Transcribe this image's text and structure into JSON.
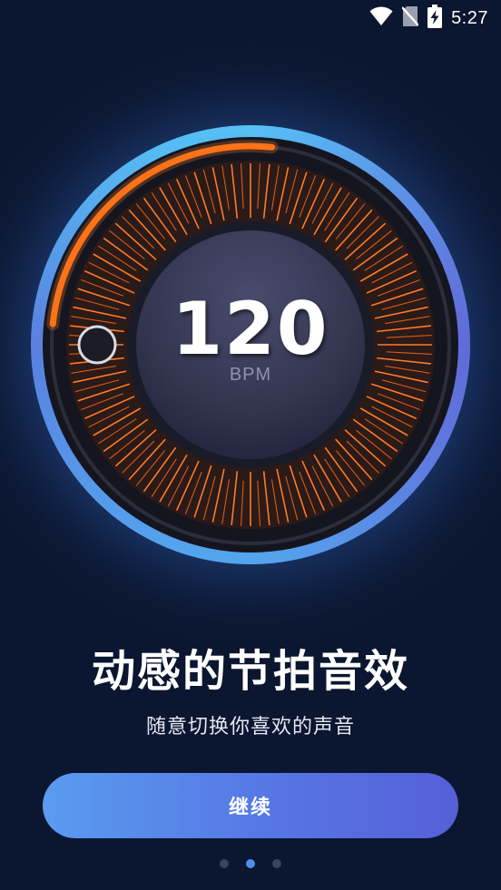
{
  "status_bar": {
    "time": "5:27",
    "icons": [
      "wifi-icon",
      "no-sim-icon",
      "battery-charging-icon"
    ]
  },
  "dial": {
    "value": "120",
    "unit": "BPM",
    "level": 0.22,
    "colors": {
      "accent": "#ff6a10",
      "ring_outer": "#4aa8ee",
      "ring_inner": "#6a5fd8",
      "center": "#3b3c5a"
    }
  },
  "onboarding": {
    "title": "动感的节拍音效",
    "subtitle": "随意切换你喜欢的声音",
    "continue_label": "继续"
  },
  "pager": {
    "count": 3,
    "active_index": 1
  }
}
